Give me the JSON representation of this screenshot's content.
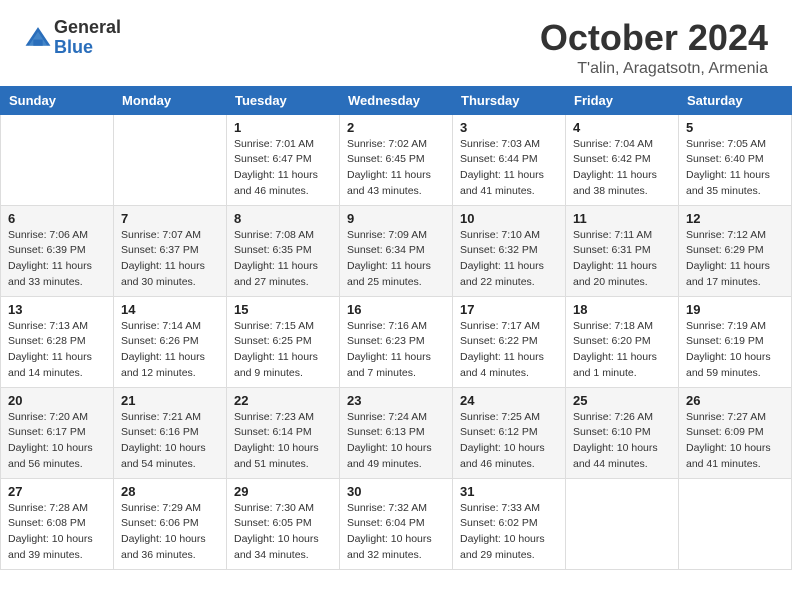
{
  "header": {
    "logo_general": "General",
    "logo_blue": "Blue",
    "month_title": "October 2024",
    "location": "T'alin, Aragatsotn, Armenia"
  },
  "columns": [
    "Sunday",
    "Monday",
    "Tuesday",
    "Wednesday",
    "Thursday",
    "Friday",
    "Saturday"
  ],
  "weeks": [
    [
      {
        "day": "",
        "sunrise": "",
        "sunset": "",
        "daylight": ""
      },
      {
        "day": "",
        "sunrise": "",
        "sunset": "",
        "daylight": ""
      },
      {
        "day": "1",
        "sunrise": "Sunrise: 7:01 AM",
        "sunset": "Sunset: 6:47 PM",
        "daylight": "Daylight: 11 hours and 46 minutes."
      },
      {
        "day": "2",
        "sunrise": "Sunrise: 7:02 AM",
        "sunset": "Sunset: 6:45 PM",
        "daylight": "Daylight: 11 hours and 43 minutes."
      },
      {
        "day": "3",
        "sunrise": "Sunrise: 7:03 AM",
        "sunset": "Sunset: 6:44 PM",
        "daylight": "Daylight: 11 hours and 41 minutes."
      },
      {
        "day": "4",
        "sunrise": "Sunrise: 7:04 AM",
        "sunset": "Sunset: 6:42 PM",
        "daylight": "Daylight: 11 hours and 38 minutes."
      },
      {
        "day": "5",
        "sunrise": "Sunrise: 7:05 AM",
        "sunset": "Sunset: 6:40 PM",
        "daylight": "Daylight: 11 hours and 35 minutes."
      }
    ],
    [
      {
        "day": "6",
        "sunrise": "Sunrise: 7:06 AM",
        "sunset": "Sunset: 6:39 PM",
        "daylight": "Daylight: 11 hours and 33 minutes."
      },
      {
        "day": "7",
        "sunrise": "Sunrise: 7:07 AM",
        "sunset": "Sunset: 6:37 PM",
        "daylight": "Daylight: 11 hours and 30 minutes."
      },
      {
        "day": "8",
        "sunrise": "Sunrise: 7:08 AM",
        "sunset": "Sunset: 6:35 PM",
        "daylight": "Daylight: 11 hours and 27 minutes."
      },
      {
        "day": "9",
        "sunrise": "Sunrise: 7:09 AM",
        "sunset": "Sunset: 6:34 PM",
        "daylight": "Daylight: 11 hours and 25 minutes."
      },
      {
        "day": "10",
        "sunrise": "Sunrise: 7:10 AM",
        "sunset": "Sunset: 6:32 PM",
        "daylight": "Daylight: 11 hours and 22 minutes."
      },
      {
        "day": "11",
        "sunrise": "Sunrise: 7:11 AM",
        "sunset": "Sunset: 6:31 PM",
        "daylight": "Daylight: 11 hours and 20 minutes."
      },
      {
        "day": "12",
        "sunrise": "Sunrise: 7:12 AM",
        "sunset": "Sunset: 6:29 PM",
        "daylight": "Daylight: 11 hours and 17 minutes."
      }
    ],
    [
      {
        "day": "13",
        "sunrise": "Sunrise: 7:13 AM",
        "sunset": "Sunset: 6:28 PM",
        "daylight": "Daylight: 11 hours and 14 minutes."
      },
      {
        "day": "14",
        "sunrise": "Sunrise: 7:14 AM",
        "sunset": "Sunset: 6:26 PM",
        "daylight": "Daylight: 11 hours and 12 minutes."
      },
      {
        "day": "15",
        "sunrise": "Sunrise: 7:15 AM",
        "sunset": "Sunset: 6:25 PM",
        "daylight": "Daylight: 11 hours and 9 minutes."
      },
      {
        "day": "16",
        "sunrise": "Sunrise: 7:16 AM",
        "sunset": "Sunset: 6:23 PM",
        "daylight": "Daylight: 11 hours and 7 minutes."
      },
      {
        "day": "17",
        "sunrise": "Sunrise: 7:17 AM",
        "sunset": "Sunset: 6:22 PM",
        "daylight": "Daylight: 11 hours and 4 minutes."
      },
      {
        "day": "18",
        "sunrise": "Sunrise: 7:18 AM",
        "sunset": "Sunset: 6:20 PM",
        "daylight": "Daylight: 11 hours and 1 minute."
      },
      {
        "day": "19",
        "sunrise": "Sunrise: 7:19 AM",
        "sunset": "Sunset: 6:19 PM",
        "daylight": "Daylight: 10 hours and 59 minutes."
      }
    ],
    [
      {
        "day": "20",
        "sunrise": "Sunrise: 7:20 AM",
        "sunset": "Sunset: 6:17 PM",
        "daylight": "Daylight: 10 hours and 56 minutes."
      },
      {
        "day": "21",
        "sunrise": "Sunrise: 7:21 AM",
        "sunset": "Sunset: 6:16 PM",
        "daylight": "Daylight: 10 hours and 54 minutes."
      },
      {
        "day": "22",
        "sunrise": "Sunrise: 7:23 AM",
        "sunset": "Sunset: 6:14 PM",
        "daylight": "Daylight: 10 hours and 51 minutes."
      },
      {
        "day": "23",
        "sunrise": "Sunrise: 7:24 AM",
        "sunset": "Sunset: 6:13 PM",
        "daylight": "Daylight: 10 hours and 49 minutes."
      },
      {
        "day": "24",
        "sunrise": "Sunrise: 7:25 AM",
        "sunset": "Sunset: 6:12 PM",
        "daylight": "Daylight: 10 hours and 46 minutes."
      },
      {
        "day": "25",
        "sunrise": "Sunrise: 7:26 AM",
        "sunset": "Sunset: 6:10 PM",
        "daylight": "Daylight: 10 hours and 44 minutes."
      },
      {
        "day": "26",
        "sunrise": "Sunrise: 7:27 AM",
        "sunset": "Sunset: 6:09 PM",
        "daylight": "Daylight: 10 hours and 41 minutes."
      }
    ],
    [
      {
        "day": "27",
        "sunrise": "Sunrise: 7:28 AM",
        "sunset": "Sunset: 6:08 PM",
        "daylight": "Daylight: 10 hours and 39 minutes."
      },
      {
        "day": "28",
        "sunrise": "Sunrise: 7:29 AM",
        "sunset": "Sunset: 6:06 PM",
        "daylight": "Daylight: 10 hours and 36 minutes."
      },
      {
        "day": "29",
        "sunrise": "Sunrise: 7:30 AM",
        "sunset": "Sunset: 6:05 PM",
        "daylight": "Daylight: 10 hours and 34 minutes."
      },
      {
        "day": "30",
        "sunrise": "Sunrise: 7:32 AM",
        "sunset": "Sunset: 6:04 PM",
        "daylight": "Daylight: 10 hours and 32 minutes."
      },
      {
        "day": "31",
        "sunrise": "Sunrise: 7:33 AM",
        "sunset": "Sunset: 6:02 PM",
        "daylight": "Daylight: 10 hours and 29 minutes."
      },
      {
        "day": "",
        "sunrise": "",
        "sunset": "",
        "daylight": ""
      },
      {
        "day": "",
        "sunrise": "",
        "sunset": "",
        "daylight": ""
      }
    ]
  ]
}
